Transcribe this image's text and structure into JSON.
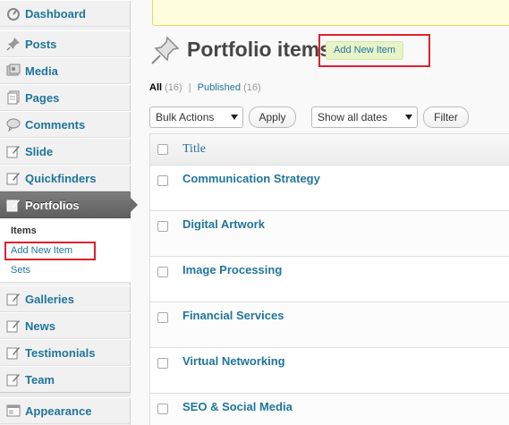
{
  "sidebar": {
    "items": [
      {
        "label": "Dashboard",
        "icon": "dashboard-icon"
      },
      {
        "label": "Posts",
        "icon": "pushpin-icon"
      },
      {
        "label": "Media",
        "icon": "media-icon"
      },
      {
        "label": "Pages",
        "icon": "pages-icon"
      },
      {
        "label": "Comments",
        "icon": "comment-bubble-icon"
      },
      {
        "label": "Slide",
        "icon": "edit-page-icon"
      },
      {
        "label": "Quickfinders",
        "icon": "edit-page-icon"
      },
      {
        "label": "Portfolios",
        "icon": "edit-page-icon"
      },
      {
        "label": "Galleries",
        "icon": "edit-page-icon"
      },
      {
        "label": "News",
        "icon": "edit-page-icon"
      },
      {
        "label": "Testimonials",
        "icon": "edit-page-icon"
      },
      {
        "label": "Team",
        "icon": "edit-page-icon"
      },
      {
        "label": "Appearance",
        "icon": "appearance-icon"
      }
    ],
    "submenu": {
      "items_label": "Items",
      "add_new_label": "Add New Item",
      "sets_label": "Sets"
    }
  },
  "page": {
    "title": "Portfolio items",
    "add_new_label": "Add New Item"
  },
  "filters": {
    "all_label": "All",
    "all_count": "(16)",
    "separator": "|",
    "published_label": "Published",
    "published_count": "(16)"
  },
  "toolbar": {
    "bulk_actions": "Bulk Actions",
    "apply_label": "Apply",
    "dates": "Show all dates",
    "filter_label": "Filter"
  },
  "table": {
    "header_title": "Title",
    "rows": [
      "Communication Strategy",
      "Digital Artwork",
      "Image Processing",
      "Financial Services",
      "Virtual Networking",
      "SEO & Social Media"
    ]
  },
  "colors": {
    "link": "#21759b",
    "highlight": "#e0202b",
    "add_new_bg": "#e8f3c8",
    "current_menu": "#6d6d6d"
  }
}
